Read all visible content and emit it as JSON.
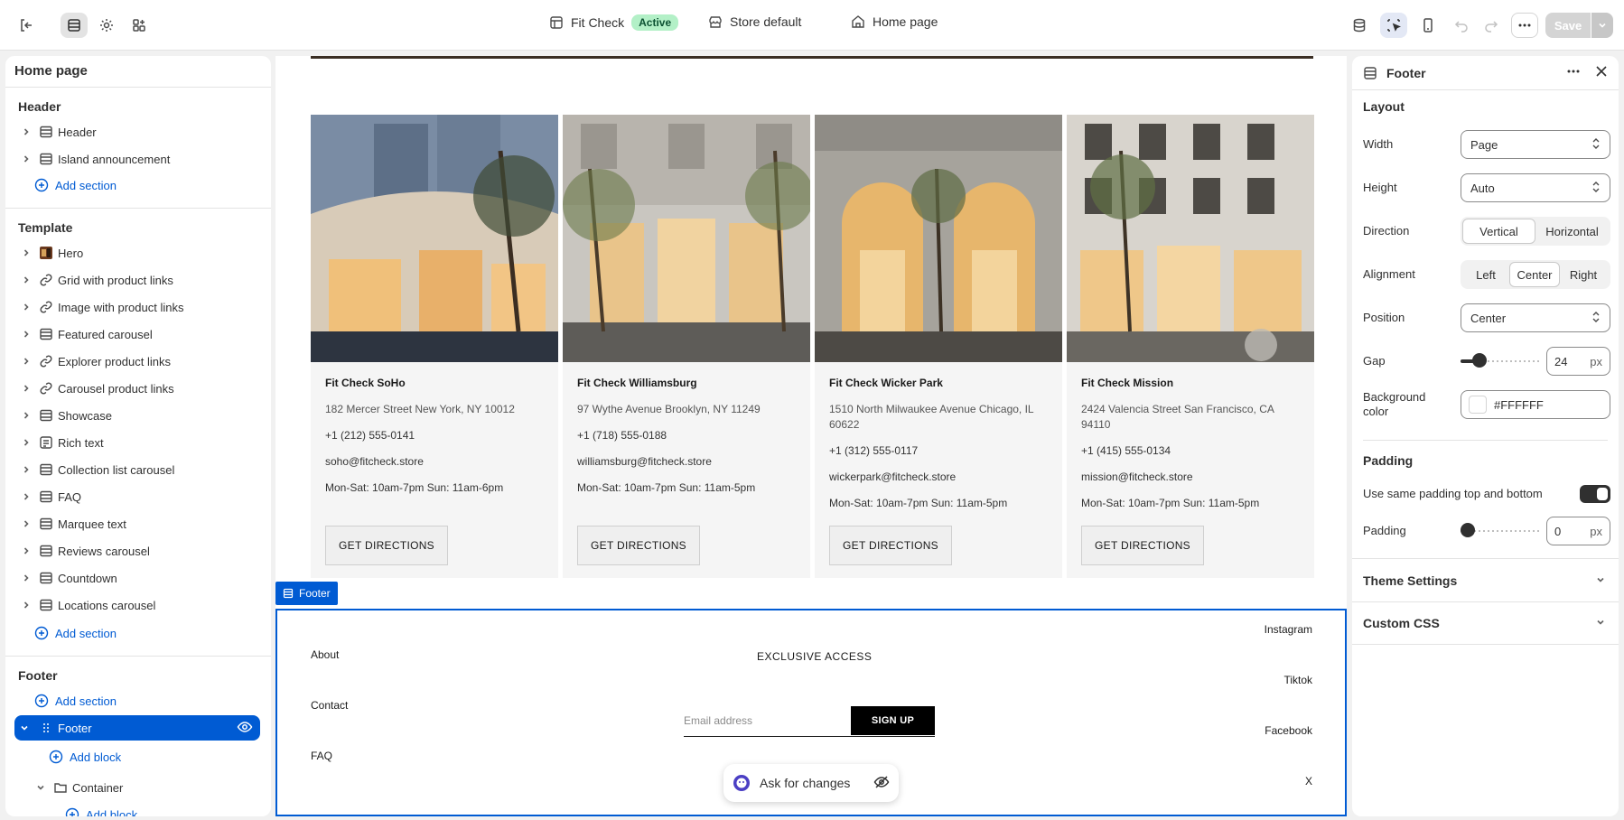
{
  "topbar": {
    "theme_name": "Fit Check",
    "theme_status": "Active",
    "store": "Store default",
    "page": "Home page",
    "save_label": "Save"
  },
  "left": {
    "title": "Home page",
    "header_group": "Header",
    "header_items": [
      "Header",
      "Island announcement"
    ],
    "template_group": "Template",
    "template_items": [
      "Hero",
      "Grid with product links",
      "Image with product links",
      "Featured carousel",
      "Explorer product links",
      "Carousel product links",
      "Showcase",
      "Rich text",
      "Collection list carousel",
      "FAQ",
      "Marquee text",
      "Reviews carousel",
      "Countdown",
      "Locations carousel"
    ],
    "footer_group": "Footer",
    "add_section": "Add section",
    "add_block": "Add block",
    "footer_item": "Footer",
    "container_item": "Container"
  },
  "stores": [
    {
      "name": "Fit Check SoHo",
      "address": "182 Mercer Street New York, NY 10012",
      "phone": "+1 (212) 555-0141",
      "email": "soho@fitcheck.store",
      "hours": "Mon-Sat: 10am-7pm Sun: 11am-6pm",
      "button": "GET DIRECTIONS"
    },
    {
      "name": "Fit Check Williamsburg",
      "address": "97 Wythe Avenue Brooklyn, NY 11249",
      "phone": "+1 (718) 555-0188",
      "email": "williamsburg@fitcheck.store",
      "hours": "Mon-Sat: 10am-7pm Sun: 11am-5pm",
      "button": "GET DIRECTIONS"
    },
    {
      "name": "Fit Check Wicker Park",
      "address": "1510 North Milwaukee Avenue Chicago, IL 60622",
      "phone": "+1 (312) 555-0117",
      "email": "wickerpark@fitcheck.store",
      "hours": "Mon-Sat: 10am-7pm Sun: 11am-5pm",
      "button": "GET DIRECTIONS"
    },
    {
      "name": "Fit Check Mission",
      "address": "2424 Valencia Street San Francisco, CA 94110",
      "phone": "+1 (415) 555-0134",
      "email": "mission@fitcheck.store",
      "hours": "Mon-Sat: 10am-7pm Sun: 11am-5pm",
      "button": "GET DIRECTIONS"
    }
  ],
  "footer": {
    "tag": "Footer",
    "links_left": [
      "About",
      "Contact",
      "FAQ"
    ],
    "links_right": [
      "Instagram",
      "Tiktok",
      "Facebook",
      "X"
    ],
    "newsletter_title": "EXCLUSIVE ACCESS",
    "email_placeholder": "Email address",
    "signup": "SIGN UP"
  },
  "ask": {
    "label": "Ask for changes"
  },
  "right": {
    "title": "Footer",
    "layout_title": "Layout",
    "width_label": "Width",
    "width_value": "Page",
    "height_label": "Height",
    "height_value": "Auto",
    "direction_label": "Direction",
    "direction_options": [
      "Vertical",
      "Horizontal"
    ],
    "direction_selected": "Vertical",
    "alignment_label": "Alignment",
    "alignment_options": [
      "Left",
      "Center",
      "Right"
    ],
    "alignment_selected": "Center",
    "position_label": "Position",
    "position_value": "Center",
    "gap_label": "Gap",
    "gap_value": "24",
    "gap_unit": "px",
    "gap_fraction": 0.24,
    "bg_label": "Background color",
    "bg_value": "#FFFFFF",
    "padding_title": "Padding",
    "same_padding_label": "Use same padding top and bottom",
    "same_padding_on": true,
    "padding_label": "Padding",
    "padding_value": "0",
    "padding_unit": "px",
    "padding_fraction": 0,
    "theme_settings": "Theme Settings",
    "custom_css": "Custom CSS"
  },
  "colors": {
    "accent": "#005bd3",
    "success_bg": "#b3f0c7"
  }
}
